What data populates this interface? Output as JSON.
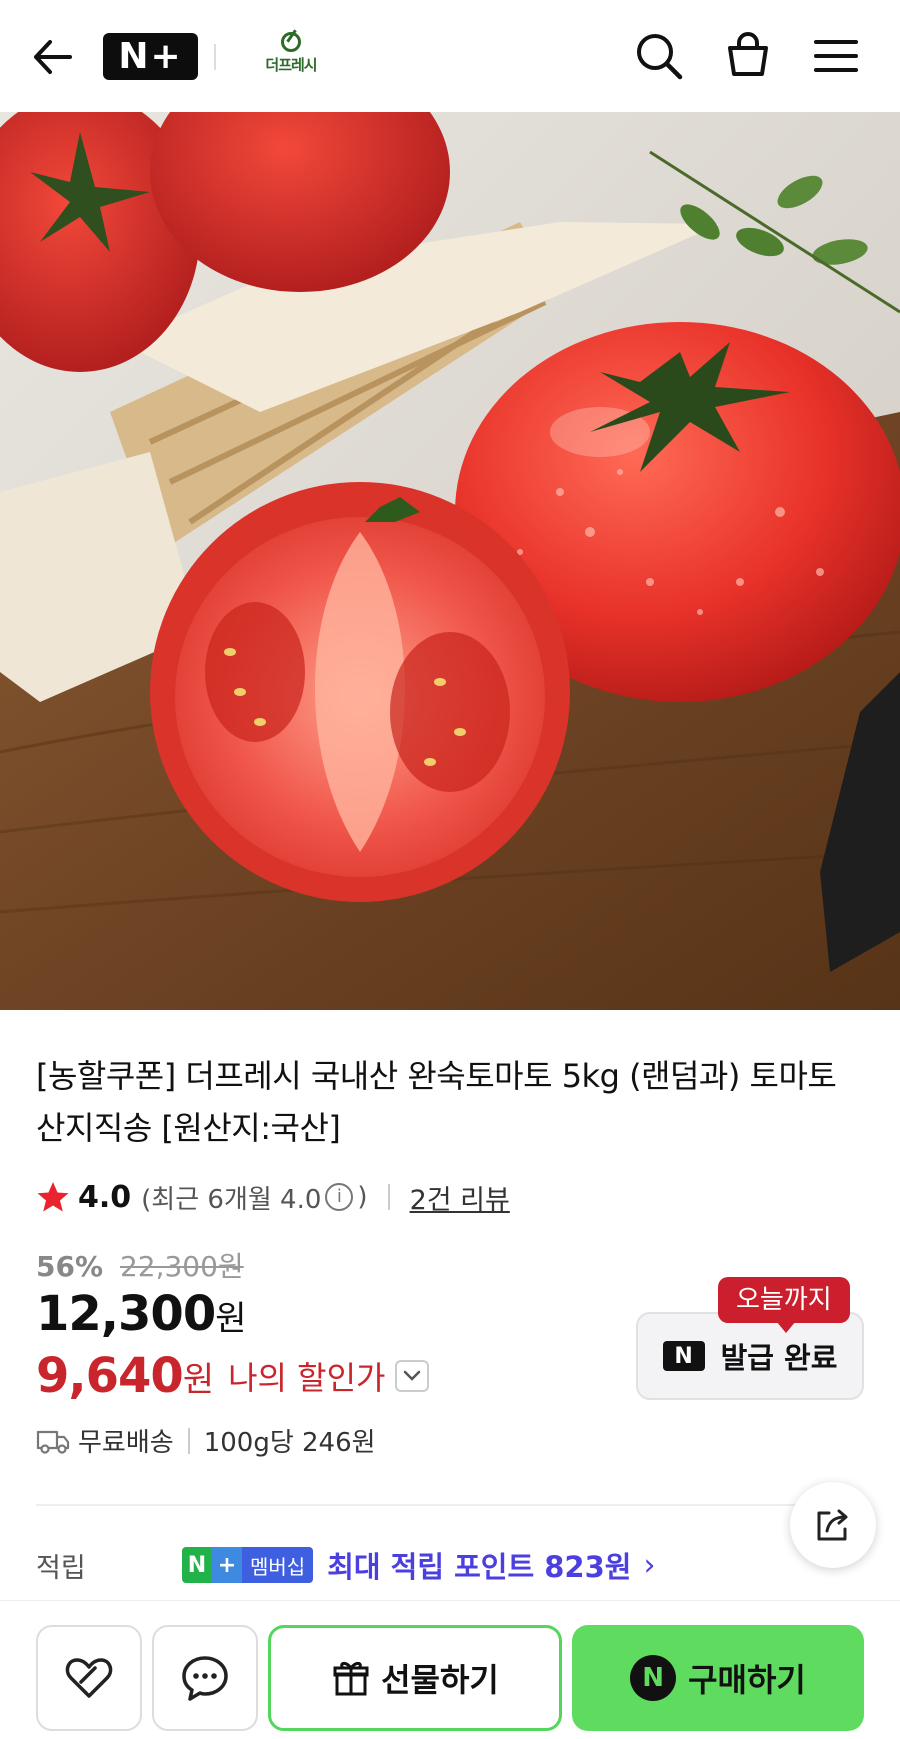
{
  "header": {
    "logo_text": "N+",
    "brand_name": "더프레시"
  },
  "product": {
    "title": "[농할쿠폰] 더프레시 국내산 완숙토마토 5kg (랜덤과) 토마토 산지직송 [원산지:국산]",
    "rating": "4.0",
    "rating_recent": "(최근 6개월 4.0",
    "rating_recent_close": ")",
    "info_icon": "i",
    "review_count": "2건 리뷰",
    "discount_pct": "56%",
    "original_price": "22,300원",
    "price": "12,300",
    "price_unit": "원",
    "my_price": "9,640",
    "my_price_unit": "원",
    "my_price_label": "나의 할인가"
  },
  "coupon": {
    "badge": "오늘까지",
    "icon_text": "N",
    "label": "발급 완료"
  },
  "delivery": {
    "label": "무료배송",
    "unit_price": "100g당 246원"
  },
  "points": {
    "label": "적립",
    "badge_n": "N",
    "badge_plus": "+",
    "badge_text": "멤버십",
    "text": "최대 적립 포인트 823원",
    "chevron": "›"
  },
  "bottom_bar": {
    "gift_label": "선물하기",
    "buy_icon": "N",
    "buy_label": "구매하기"
  },
  "colors": {
    "accent_red": "#c9252c",
    "buy_green": "#5fdc5f",
    "points_purple": "#4b3fe0"
  }
}
